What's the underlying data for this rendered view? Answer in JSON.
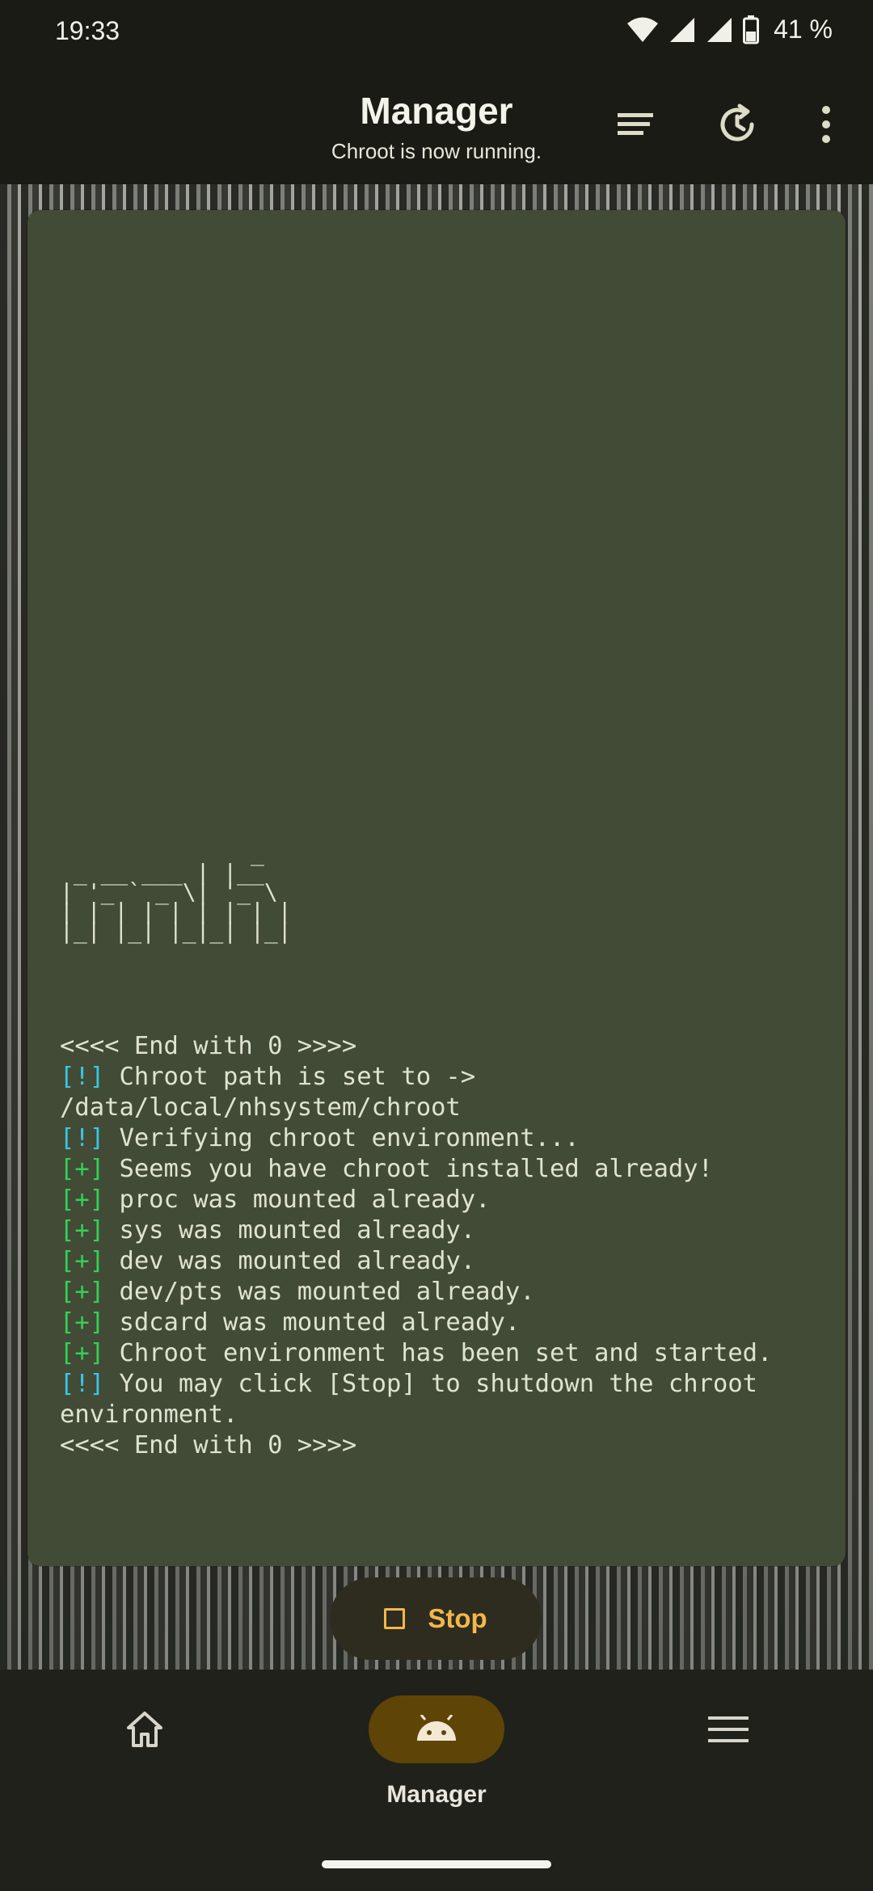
{
  "status_bar": {
    "time": "19:33",
    "battery": "41 %"
  },
  "app_bar": {
    "title": "Manager",
    "subtitle": "Chroot is now running.",
    "icons": [
      "sort-lines-icon",
      "history-refresh-icon",
      "more-vert-icon"
    ]
  },
  "terminal": {
    "ascii_art": "              _\n _ __ ___ | |__\n| '_ ` _ \\| '_ \\\n| | | | | | | | |\n|_| |_| |_|_| |_|",
    "lines": [
      {
        "tag": "",
        "text": "<<<< End with 0 >>>>"
      },
      {
        "tag": "[!]",
        "text": " Chroot path is set to -> /data/local/nhsystem/chroot"
      },
      {
        "tag": "[!]",
        "text": " Verifying chroot environment..."
      },
      {
        "tag": "[+]",
        "text": " Seems you have chroot installed already!"
      },
      {
        "tag": "[+]",
        "text": " proc was mounted already."
      },
      {
        "tag": "[+]",
        "text": " sys was mounted already."
      },
      {
        "tag": "[+]",
        "text": " dev was mounted already."
      },
      {
        "tag": "[+]",
        "text": " dev/pts was mounted already."
      },
      {
        "tag": "[+]",
        "text": " sdcard was mounted already."
      },
      {
        "tag": "[+]",
        "text": " Chroot environment has been set and started."
      },
      {
        "tag": "[!]",
        "text": " You may click [Stop] to shutdown the chroot environment."
      },
      {
        "tag": "",
        "text": "<<<< End with 0 >>>>"
      }
    ],
    "colors": {
      "info": "#39c6e6",
      "ok": "#34d058"
    }
  },
  "stop_button": {
    "label": "Stop"
  },
  "bottom_nav": {
    "items": [
      {
        "icon": "home-icon",
        "label": ""
      },
      {
        "icon": "android-icon",
        "label": "Manager"
      },
      {
        "icon": "menu-icon",
        "label": ""
      }
    ],
    "active_color": "#5e4406"
  }
}
